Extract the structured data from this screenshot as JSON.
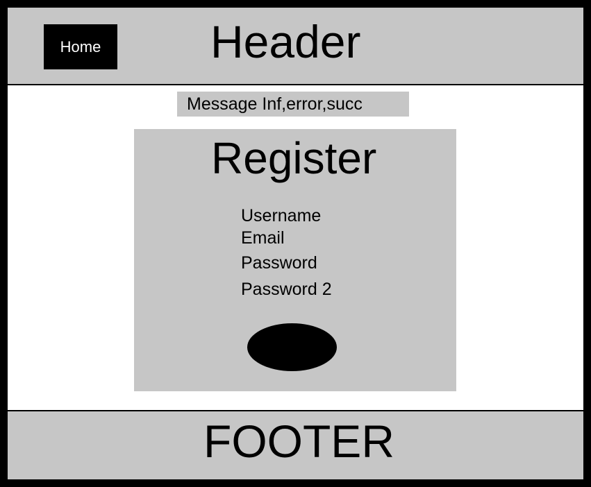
{
  "header": {
    "home_label": "Home",
    "title": "Header"
  },
  "message": {
    "text": "Message Inf,error,succ"
  },
  "register": {
    "title": "Register",
    "fields": [
      {
        "label": "Username"
      },
      {
        "label": "Email"
      },
      {
        "label": "Password"
      },
      {
        "label": "Password 2"
      }
    ]
  },
  "footer": {
    "title": "FOOTER"
  },
  "colors": {
    "panel_gray": "#c6c6c6",
    "frame_black": "#000000",
    "background_white": "#ffffff"
  }
}
